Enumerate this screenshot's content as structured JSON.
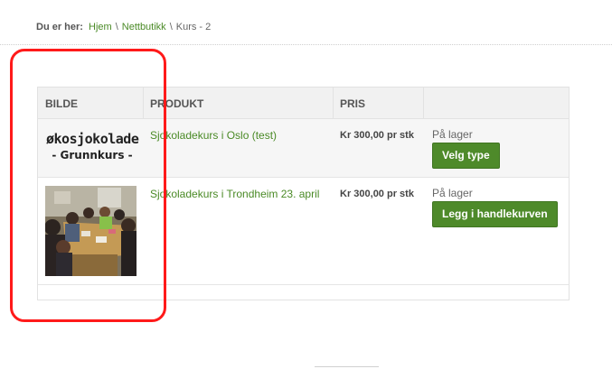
{
  "breadcrumb": {
    "label": "Du er her:",
    "items": [
      "Hjem",
      "Nettbutikk",
      "Kurs - 2"
    ],
    "separator": "\\"
  },
  "table": {
    "headers": [
      "BILDE",
      "PRODUKT",
      "PRIS",
      ""
    ],
    "rows": [
      {
        "image_text_line1": "økosjokolade",
        "image_text_line2": "- Grunnkurs -",
        "product": "Sjokoladekurs i Oslo (test)",
        "price": "Kr 300,00 pr stk",
        "stock": "På lager",
        "button": "Velg type"
      },
      {
        "image": "photo-of-course-participants",
        "product": "Sjokoladekurs i Trondheim 23. april",
        "price": "Kr 300,00 pr stk",
        "stock": "På lager",
        "button": "Legg i handlekurven"
      }
    ]
  },
  "colors": {
    "link_green": "#4a8a26",
    "button_green": "#4e8a2a",
    "annotation_red": "#ff1a1a"
  }
}
